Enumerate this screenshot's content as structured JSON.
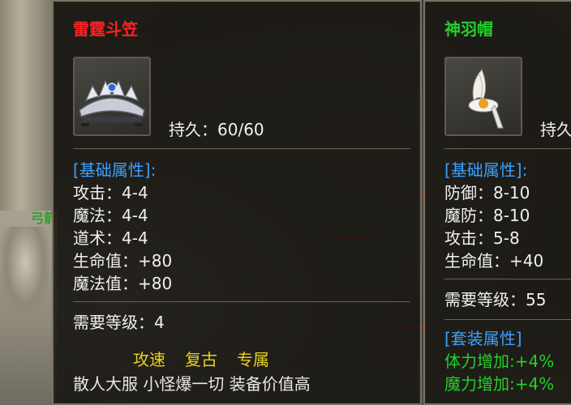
{
  "left_item": {
    "name": "雷霆斗笠",
    "durability_label": "持久：",
    "durability_value": "60/60",
    "base_header": "[基础属性]:",
    "stats": [
      {
        "label": "攻击：",
        "value": "4-4"
      },
      {
        "label": "魔法：",
        "value": "4-4"
      },
      {
        "label": "道术：",
        "value": "4-4"
      },
      {
        "label": "生命值：",
        "value": "+80"
      },
      {
        "label": "魔法值：",
        "value": "+80"
      }
    ],
    "level_label": "需要等级：",
    "level_value": "4",
    "tags": [
      "攻速",
      "复古",
      "专属"
    ],
    "slogan": "散人大服 小怪爆一切 装备价值高"
  },
  "right_item": {
    "name": "神羽帽",
    "durability_label": "持久",
    "base_header": "[基础属性]:",
    "stats": [
      {
        "label": "防御：",
        "value": "8-10"
      },
      {
        "label": "魔防：",
        "value": "8-10"
      },
      {
        "label": "攻击：",
        "value": "5-8"
      },
      {
        "label": "生命值：",
        "value": "+40"
      }
    ],
    "level_label": "需要等级：",
    "level_value": "55",
    "set_header": "[套装属性]",
    "set_bonuses": [
      "体力增加:+4%",
      "魔力增加:+4%"
    ]
  },
  "world": {
    "npc_text": "弓箭"
  },
  "colors": {
    "left_name": "#ff2222",
    "right_name": "#22d02a",
    "section_header": "#3aa0ff",
    "set_bonus": "#22d02a",
    "tag": "#e8d21a"
  }
}
